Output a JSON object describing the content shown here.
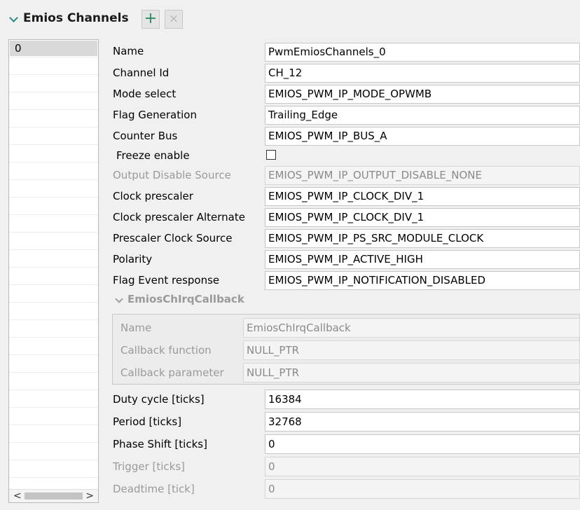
{
  "header": {
    "title": "Emios Channels",
    "add_label": "+",
    "remove_label": "×"
  },
  "list": {
    "items": [
      "0"
    ],
    "scroll_left": "<",
    "scroll_right": ">"
  },
  "form": {
    "fields": [
      {
        "label": "Name",
        "value": "PwmEmiosChannels_0"
      },
      {
        "label": "Channel Id",
        "value": "CH_12"
      },
      {
        "label": "Mode select",
        "value": "EMIOS_PWM_IP_MODE_OPWMB"
      },
      {
        "label": "Flag Generation",
        "value": "Trailing_Edge"
      },
      {
        "label": "Counter Bus",
        "value": "EMIOS_PWM_IP_BUS_A"
      },
      {
        "label": "Freeze enable",
        "checked": false
      },
      {
        "label": "Output Disable Source",
        "value": "EMIOS_PWM_IP_OUTPUT_DISABLE_NONE",
        "disabled": true
      },
      {
        "label": "Clock prescaler",
        "value": "EMIOS_PWM_IP_CLOCK_DIV_1"
      },
      {
        "label": "Clock prescaler Alternate",
        "value": "EMIOS_PWM_IP_CLOCK_DIV_1"
      },
      {
        "label": "Prescaler Clock Source",
        "value": "EMIOS_PWM_IP_PS_SRC_MODULE_CLOCK"
      },
      {
        "label": "Polarity",
        "value": "EMIOS_PWM_IP_ACTIVE_HIGH"
      },
      {
        "label": "Flag Event response",
        "value": "EMIOS_PWM_IP_NOTIFICATION_DISABLED"
      }
    ],
    "callback_section": {
      "title": "EmiosChIrqCallback",
      "fields": [
        {
          "label": "Name",
          "value": "EmiosChIrqCallback"
        },
        {
          "label": "Callback function",
          "value": "NULL_PTR"
        },
        {
          "label": "Callback parameter",
          "value": "NULL_PTR"
        }
      ]
    },
    "ticks": [
      {
        "label": "Duty cycle [ticks]",
        "value": "16384"
      },
      {
        "label": "Period [ticks]",
        "value": "32768"
      },
      {
        "label": "Phase Shift [ticks]",
        "value": "0"
      },
      {
        "label": "Trigger [ticks]",
        "value": "0",
        "disabled": true
      },
      {
        "label": "Deadtime [tick]",
        "value": "0",
        "disabled": true
      }
    ]
  }
}
